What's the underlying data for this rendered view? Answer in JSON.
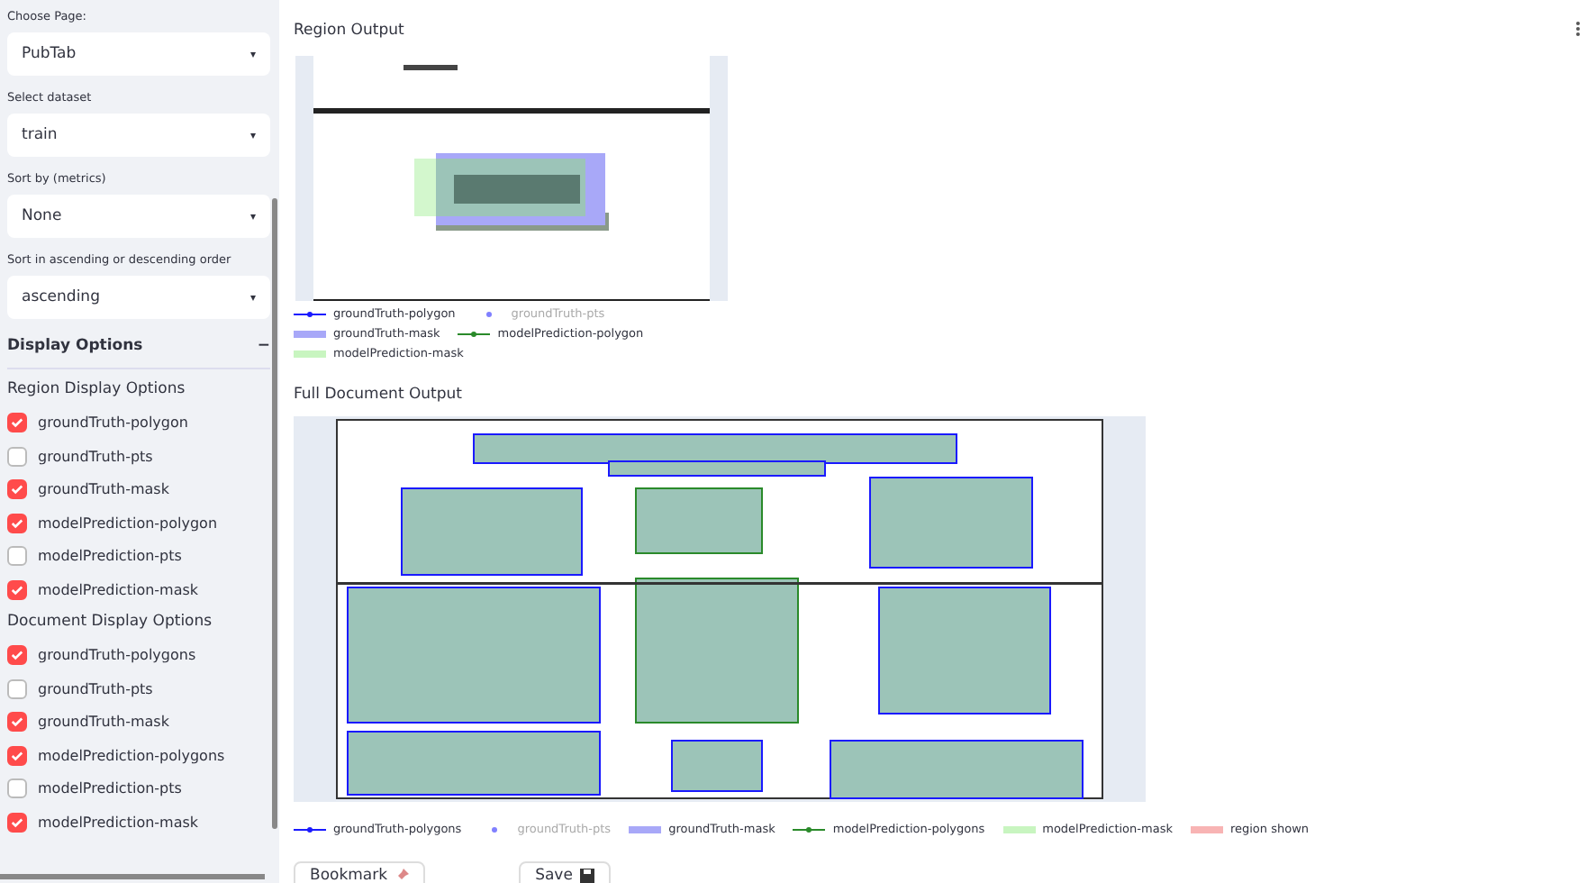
{
  "sidebar": {
    "selects": [
      {
        "label": "Choose Page:",
        "value": "PubTab",
        "caret": "▾"
      },
      {
        "label": "Select dataset",
        "value": "train",
        "caret": "▾"
      },
      {
        "label": "Sort by (metrics)",
        "value": "None",
        "caret": "▾"
      },
      {
        "label": "Sort in ascending or descending order",
        "value": "ascending",
        "caret": "▾"
      }
    ],
    "expander": {
      "title": "Display Options",
      "toggle": "−",
      "expanded": true,
      "groups": [
        {
          "title": "Region Display Options",
          "options": [
            {
              "label": "groundTruth-polygon",
              "checked": true
            },
            {
              "label": "groundTruth-pts",
              "checked": false
            },
            {
              "label": "groundTruth-mask",
              "checked": true
            },
            {
              "label": "modelPrediction-polygon",
              "checked": true
            },
            {
              "label": "modelPrediction-pts",
              "checked": false
            },
            {
              "label": "modelPrediction-mask",
              "checked": true
            }
          ]
        },
        {
          "title": "Document Display Options",
          "options": [
            {
              "label": "groundTruth-polygons",
              "checked": true
            },
            {
              "label": "groundTruth-pts",
              "checked": false
            },
            {
              "label": "groundTruth-mask",
              "checked": true
            },
            {
              "label": "modelPrediction-polygons",
              "checked": true
            },
            {
              "label": "modelPrediction-pts",
              "checked": false
            },
            {
              "label": "modelPrediction-mask",
              "checked": true
            }
          ]
        }
      ]
    }
  },
  "region_output": {
    "title": "Region Output",
    "legend": [
      {
        "label": "groundTruth-polygon",
        "kind": "line",
        "color": "#1a1aff",
        "disabled": false
      },
      {
        "label": "groundTruth-pts",
        "kind": "dot",
        "color": "#8080ff",
        "disabled": true
      },
      {
        "label": "groundTruth-mask",
        "kind": "bar",
        "color": "#a8a8f8",
        "disabled": false
      },
      {
        "label": "modelPrediction-polygon",
        "kind": "line",
        "color": "#2a8a2a",
        "disabled": false
      },
      {
        "label": "modelPrediction-mask",
        "kind": "bar",
        "color": "#c8f5c0",
        "disabled": false
      }
    ]
  },
  "document_output": {
    "title": "Full Document Output",
    "legend": [
      {
        "label": "groundTruth-polygons",
        "kind": "line",
        "color": "#1a1aff",
        "disabled": false
      },
      {
        "label": "groundTruth-pts",
        "kind": "dot",
        "color": "#8080ff",
        "disabled": true
      },
      {
        "label": "groundTruth-mask",
        "kind": "bar",
        "color": "#a8a8f8",
        "disabled": false
      },
      {
        "label": "modelPrediction-polygons",
        "kind": "line",
        "color": "#2a8a2a",
        "disabled": false
      },
      {
        "label": "modelPrediction-mask",
        "kind": "bar",
        "color": "#c8f5c0",
        "disabled": false
      },
      {
        "label": "region shown",
        "kind": "bar",
        "color": "#f8b4b4",
        "disabled": false
      }
    ]
  },
  "buttons": [
    {
      "label": "Bookmark"
    },
    {
      "label": "Save"
    }
  ]
}
